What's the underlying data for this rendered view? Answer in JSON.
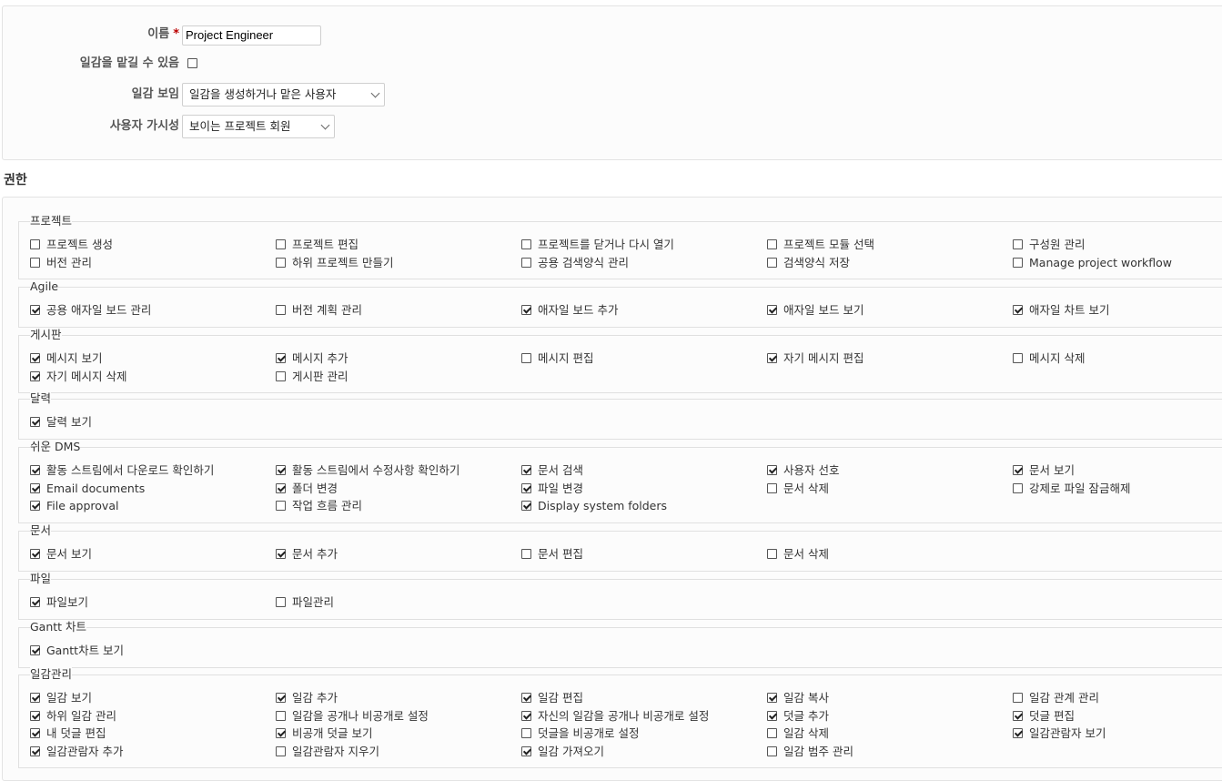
{
  "form": {
    "name_label": "이름",
    "required_mark": "*",
    "name_value": "Project Engineer",
    "assignable_label": "일감을 맡길 수 있음",
    "assignable_checked": false,
    "issues_visibility_label": "일감 보임",
    "issues_visibility_value": "일감을 생성하거나 맡은 사용자",
    "users_visibility_label": "사용자 가시성",
    "users_visibility_value": "보이는 프로젝트 회원"
  },
  "permissions_title": "권한",
  "groups": [
    {
      "legend": "프로젝트",
      "items": [
        {
          "label": "프로젝트 생성",
          "checked": false
        },
        {
          "label": "프로젝트 편집",
          "checked": false
        },
        {
          "label": "프로젝트를 닫거나 다시 열기",
          "checked": false
        },
        {
          "label": "프로젝트 모듈 선택",
          "checked": false
        },
        {
          "label": "구성원 관리",
          "checked": false
        },
        {
          "label": "버전 관리",
          "checked": false
        },
        {
          "label": "하위 프로젝트 만들기",
          "checked": false
        },
        {
          "label": "공용 검색양식 관리",
          "checked": false
        },
        {
          "label": "검색양식 저장",
          "checked": false
        },
        {
          "label": "Manage project workflow",
          "checked": false
        }
      ]
    },
    {
      "legend": "Agile",
      "items": [
        {
          "label": "공용 애자일 보드 관리",
          "checked": true
        },
        {
          "label": "버전 계획 관리",
          "checked": false
        },
        {
          "label": "애자일 보드 추가",
          "checked": true
        },
        {
          "label": "애자일 보드 보기",
          "checked": true
        },
        {
          "label": "애자일 차트 보기",
          "checked": true
        }
      ]
    },
    {
      "legend": "게시판",
      "items": [
        {
          "label": "메시지 보기",
          "checked": true
        },
        {
          "label": "메시지 추가",
          "checked": true
        },
        {
          "label": "메시지 편집",
          "checked": false
        },
        {
          "label": "자기 메시지 편집",
          "checked": true
        },
        {
          "label": "메시지 삭제",
          "checked": false
        },
        {
          "label": "자기 메시지 삭제",
          "checked": true
        },
        {
          "label": "게시판 관리",
          "checked": false
        }
      ]
    },
    {
      "legend": "달력",
      "items": [
        {
          "label": "달력 보기",
          "checked": true
        }
      ]
    },
    {
      "legend": "쉬운 DMS",
      "items": [
        {
          "label": "활동 스트림에서 다운로드 확인하기",
          "checked": true
        },
        {
          "label": "활동 스트림에서 수정사항 확인하기",
          "checked": true
        },
        {
          "label": "문서 검색",
          "checked": true
        },
        {
          "label": "사용자 선호",
          "checked": true
        },
        {
          "label": "문서 보기",
          "checked": true
        },
        {
          "label": "Email documents",
          "checked": true
        },
        {
          "label": "폴더 변경",
          "checked": true
        },
        {
          "label": "파일 변경",
          "checked": true
        },
        {
          "label": "문서 삭제",
          "checked": false
        },
        {
          "label": "강제로 파일 잠금해제",
          "checked": false
        },
        {
          "label": "File approval",
          "checked": true
        },
        {
          "label": "작업 흐름 관리",
          "checked": false
        },
        {
          "label": "Display system folders",
          "checked": true
        }
      ]
    },
    {
      "legend": "문서",
      "items": [
        {
          "label": "문서 보기",
          "checked": true
        },
        {
          "label": "문서 추가",
          "checked": true
        },
        {
          "label": "문서 편집",
          "checked": false
        },
        {
          "label": "문서 삭제",
          "checked": false
        }
      ]
    },
    {
      "legend": "파일",
      "items": [
        {
          "label": "파일보기",
          "checked": true
        },
        {
          "label": "파일관리",
          "checked": false
        }
      ]
    },
    {
      "legend": "Gantt 차트",
      "items": [
        {
          "label": "Gantt차트 보기",
          "checked": true
        }
      ]
    },
    {
      "legend": "일감관리",
      "items": [
        {
          "label": "일감 보기",
          "checked": true
        },
        {
          "label": "일감 추가",
          "checked": true
        },
        {
          "label": "일감 편집",
          "checked": true
        },
        {
          "label": "일감 복사",
          "checked": true
        },
        {
          "label": "일감 관계 관리",
          "checked": false
        },
        {
          "label": "하위 일감 관리",
          "checked": true
        },
        {
          "label": "일감을 공개나 비공개로 설정",
          "checked": false
        },
        {
          "label": "자신의 일감을 공개나 비공개로 설정",
          "checked": true
        },
        {
          "label": "덧글 추가",
          "checked": true
        },
        {
          "label": "덧글 편집",
          "checked": true
        },
        {
          "label": "내 덧글 편집",
          "checked": true
        },
        {
          "label": "비공개 덧글 보기",
          "checked": true
        },
        {
          "label": "덧글을 비공개로 설정",
          "checked": false
        },
        {
          "label": "일감 삭제",
          "checked": false
        },
        {
          "label": "일감관람자 보기",
          "checked": true
        },
        {
          "label": "일감관람자 추가",
          "checked": true
        },
        {
          "label": "일감관람자 지우기",
          "checked": false
        },
        {
          "label": "일감 가져오기",
          "checked": true
        },
        {
          "label": "일감 범주 관리",
          "checked": false
        }
      ]
    }
  ]
}
